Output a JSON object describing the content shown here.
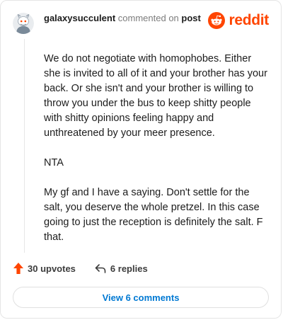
{
  "comment": {
    "author": "galaxysucculent",
    "action_text": "commented on",
    "link_text": "post",
    "paragraphs": [
      "We do not negotiate with homophobes. Either she is invited to all of it and your brother has your back. Or she isn't and your brother is willing to throw you under the bus to keep shitty people with shitty opinions feeling happy and unthreatened by your meer presence.",
      "NTA",
      "My gf and I have a saying. Don't settle for the salt, you deserve the whole pretzel. In this case going to just the reception is definitely the salt. F that."
    ]
  },
  "brand": {
    "name": "reddit",
    "color": "#ff4500"
  },
  "actions": {
    "upvotes": "30 upvotes",
    "replies": "6 replies"
  },
  "view_button": "View 6 comments",
  "colors": {
    "accent": "#0079d3",
    "upvote": "#ff4500"
  }
}
